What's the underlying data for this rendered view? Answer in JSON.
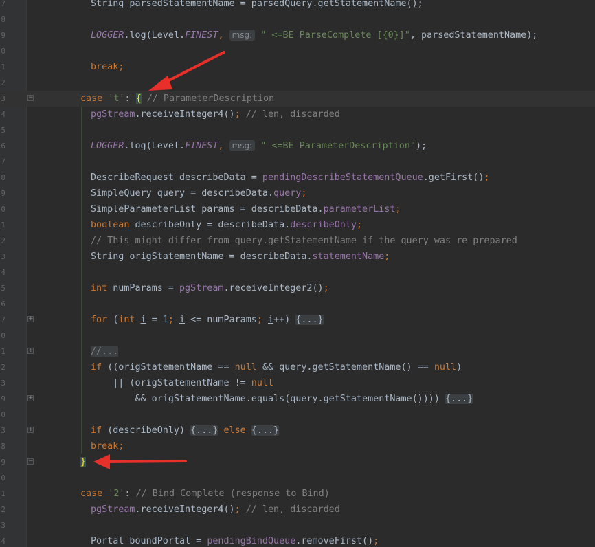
{
  "editor": {
    "colors": {
      "background": "#2b2b2b",
      "keyword": "#cc7832",
      "string": "#6a8759",
      "number": "#6897bb",
      "comment": "#808080",
      "field": "#9876aa",
      "text": "#a9b7c6",
      "brace_highlight": "#ffef28",
      "annotation_arrow": "#e8302a"
    },
    "lines": [
      {
        "num": "7",
        "tokens": [
          {
            "t": "String parsedStatementName = parsedQuery.getStatementName();",
            "c": "text"
          }
        ]
      },
      {
        "num": "8",
        "tokens": []
      },
      {
        "num": "9",
        "tokens": [
          {
            "t": "LOGGER",
            "c": "static"
          },
          {
            "t": ".log(Level.",
            "c": "text"
          },
          {
            "t": "FINEST",
            "c": "static"
          },
          {
            "t": ", ",
            "c": "kw"
          },
          {
            "t": "msg:",
            "c": "hint"
          },
          {
            "t": " \" <=BE ParseComplete [{0}]\"",
            "c": "str"
          },
          {
            "t": ", parsedStatementName);",
            "c": "text"
          }
        ]
      },
      {
        "num": "0",
        "tokens": []
      },
      {
        "num": "1",
        "tokens": [
          {
            "t": "break",
            "c": "kw"
          },
          {
            "t": ";",
            "c": "kw"
          }
        ]
      },
      {
        "num": "2",
        "tokens": []
      },
      {
        "num": "3",
        "current": true,
        "fold": "minus",
        "tokens": [
          {
            "t": "case ",
            "c": "kw"
          },
          {
            "t": "'t'",
            "c": "str"
          },
          {
            "t": ": ",
            "c": "text"
          },
          {
            "t": "{",
            "c": "brace"
          },
          {
            "t": " // ParameterDescription",
            "c": "cmt"
          }
        ]
      },
      {
        "num": "4",
        "tokens": [
          {
            "t": "pgStream",
            "c": "field"
          },
          {
            "t": ".receiveInteger4()",
            "c": "text"
          },
          {
            "t": "; ",
            "c": "kw"
          },
          {
            "t": "// len, discarded",
            "c": "cmt"
          }
        ]
      },
      {
        "num": "5",
        "tokens": []
      },
      {
        "num": "6",
        "tokens": [
          {
            "t": "LOGGER",
            "c": "static"
          },
          {
            "t": ".log(Level.",
            "c": "text"
          },
          {
            "t": "FINEST",
            "c": "static"
          },
          {
            "t": ", ",
            "c": "kw"
          },
          {
            "t": "msg:",
            "c": "hint"
          },
          {
            "t": " \" <=BE ParameterDescription\"",
            "c": "str"
          },
          {
            "t": ");",
            "c": "text"
          }
        ]
      },
      {
        "num": "7",
        "tokens": []
      },
      {
        "num": "8",
        "tokens": [
          {
            "t": "DescribeRequest describeData = ",
            "c": "text"
          },
          {
            "t": "pendingDescribeStatementQueue",
            "c": "field"
          },
          {
            "t": ".getFirst()",
            "c": "text"
          },
          {
            "t": ";",
            "c": "kw"
          }
        ]
      },
      {
        "num": "9",
        "tokens": [
          {
            "t": "SimpleQuery query = describeData.",
            "c": "text"
          },
          {
            "t": "query",
            "c": "field"
          },
          {
            "t": ";",
            "c": "kw"
          }
        ]
      },
      {
        "num": "0",
        "tokens": [
          {
            "t": "SimpleParameterList params = describeData.",
            "c": "text"
          },
          {
            "t": "parameterList",
            "c": "field"
          },
          {
            "t": ";",
            "c": "kw"
          }
        ]
      },
      {
        "num": "1",
        "tokens": [
          {
            "t": "boolean ",
            "c": "kw"
          },
          {
            "t": "describeOnly = describeData.",
            "c": "text"
          },
          {
            "t": "describeOnly",
            "c": "field"
          },
          {
            "t": ";",
            "c": "kw"
          }
        ]
      },
      {
        "num": "2",
        "tokens": [
          {
            "t": "// This might differ from query.getStatementName if the query was re-prepared",
            "c": "cmt"
          }
        ]
      },
      {
        "num": "3",
        "tokens": [
          {
            "t": "String origStatementName = describeData.",
            "c": "text"
          },
          {
            "t": "statementName",
            "c": "field"
          },
          {
            "t": ";",
            "c": "kw"
          }
        ]
      },
      {
        "num": "4",
        "tokens": []
      },
      {
        "num": "5",
        "tokens": [
          {
            "t": "int ",
            "c": "kw"
          },
          {
            "t": "numParams = ",
            "c": "text"
          },
          {
            "t": "pgStream",
            "c": "field"
          },
          {
            "t": ".receiveInteger2()",
            "c": "text"
          },
          {
            "t": ";",
            "c": "kw"
          }
        ]
      },
      {
        "num": "6",
        "tokens": []
      },
      {
        "num": "7",
        "fold": "plus",
        "tokens": [
          {
            "t": "for ",
            "c": "kw"
          },
          {
            "t": "(",
            "c": "text"
          },
          {
            "t": "int ",
            "c": "kw"
          },
          {
            "t": "i",
            "c": "ul"
          },
          {
            "t": " = ",
            "c": "text"
          },
          {
            "t": "1",
            "c": "num"
          },
          {
            "t": "; ",
            "c": "kw"
          },
          {
            "t": "i",
            "c": "ul"
          },
          {
            "t": " <= numParams",
            "c": "text"
          },
          {
            "t": "; ",
            "c": "kw"
          },
          {
            "t": "i",
            "c": "ul"
          },
          {
            "t": "++) ",
            "c": "text"
          },
          {
            "t": "{...}",
            "c": "fold"
          }
        ]
      },
      {
        "num": "0",
        "tokens": []
      },
      {
        "num": "1",
        "fold": "plus",
        "tokens": [
          {
            "t": "//...",
            "c": "foldcmt"
          }
        ]
      },
      {
        "num": "2",
        "tokens": [
          {
            "t": "if ",
            "c": "kw"
          },
          {
            "t": "((origStatementName == ",
            "c": "text"
          },
          {
            "t": "null ",
            "c": "kw"
          },
          {
            "t": "&& query.getStatementName() == ",
            "c": "text"
          },
          {
            "t": "null",
            "c": "kw"
          },
          {
            "t": ")",
            "c": "text"
          }
        ]
      },
      {
        "num": "3",
        "tokens": [
          {
            "t": "    || (origStatementName != ",
            "c": "text"
          },
          {
            "t": "null",
            "c": "kw"
          }
        ]
      },
      {
        "num": "9",
        "fold": "plus",
        "tokens": [
          {
            "t": "        && origStatementName.equals(query.getStatementName()))) ",
            "c": "text"
          },
          {
            "t": "{...}",
            "c": "fold"
          }
        ]
      },
      {
        "num": "0",
        "tokens": []
      },
      {
        "num": "3",
        "fold": "plus",
        "tokens": [
          {
            "t": "if ",
            "c": "kw"
          },
          {
            "t": "(describeOnly) ",
            "c": "text"
          },
          {
            "t": "{...}",
            "c": "fold"
          },
          {
            "t": " else ",
            "c": "kw"
          },
          {
            "t": "{...}",
            "c": "fold"
          }
        ]
      },
      {
        "num": "8",
        "tokens": [
          {
            "t": "break",
            "c": "kw"
          },
          {
            "t": ";",
            "c": "kw"
          }
        ]
      },
      {
        "num": "9",
        "fold": "minus",
        "tokens": [
          {
            "t": "}",
            "c": "brace"
          }
        ]
      },
      {
        "num": "0",
        "tokens": []
      },
      {
        "num": "1",
        "tokens": [
          {
            "t": "case ",
            "c": "kw"
          },
          {
            "t": "'2'",
            "c": "str"
          },
          {
            "t": ": ",
            "c": "text"
          },
          {
            "t": "// Bind Complete (response to Bind)",
            "c": "cmt"
          }
        ]
      },
      {
        "num": "2",
        "tokens": [
          {
            "t": "pgStream",
            "c": "field"
          },
          {
            "t": ".receiveInteger4()",
            "c": "text"
          },
          {
            "t": "; ",
            "c": "kw"
          },
          {
            "t": "// len, discarded",
            "c": "cmt"
          }
        ]
      },
      {
        "num": "3",
        "tokens": []
      },
      {
        "num": "4",
        "tokens": [
          {
            "t": "Portal boundPortal = ",
            "c": "text"
          },
          {
            "t": "pendingBindQueue",
            "c": "field"
          },
          {
            "t": ".removeFirst()",
            "c": "text"
          },
          {
            "t": ";",
            "c": "kw"
          }
        ]
      }
    ]
  }
}
